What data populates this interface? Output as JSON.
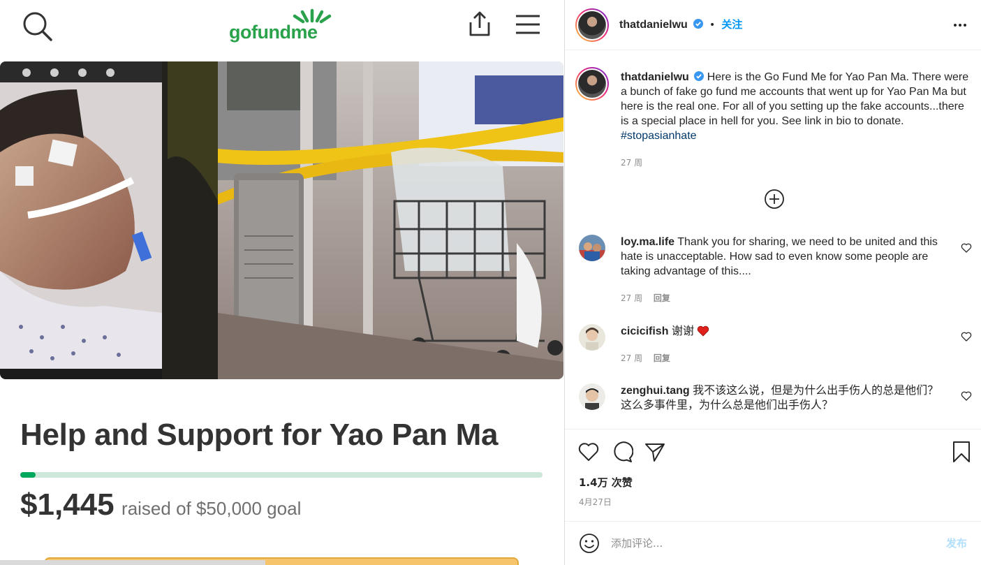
{
  "gofundme": {
    "logo_text": "gofundme",
    "brand_color": "#2aa24c",
    "title": "Help and Support for Yao Pan Ma",
    "raised_amount": "$1,445",
    "raised_text": "raised of $50,000 goal",
    "progress_fraction": 0.029,
    "icons": [
      "search-icon",
      "share-icon",
      "hamburger-menu-icon"
    ]
  },
  "instagram": {
    "header": {
      "username": "thatdanielwu",
      "separator": "•",
      "follow_label": "关注"
    },
    "post": {
      "username": "thatdanielwu",
      "caption": "Here is the Go Fund Me for Yao Pan Ma. There were a bunch of fake go fund me accounts that went up for Yao Pan Ma but here is the real one. For all of you setting up the fake accounts...there is a special place in hell for you. See link in bio to donate.",
      "hashtag": "#stopasianhate",
      "time": "27 周"
    },
    "comments": [
      {
        "username": "loy.ma.life",
        "text": "Thank you for sharing, we need to be united and this hate is unacceptable. How sad to even know some people are taking advantage of this....",
        "time": "27 周",
        "reply": "回复"
      },
      {
        "username": "cicicifish",
        "text": "谢谢",
        "time": "27 周",
        "reply": "回复"
      },
      {
        "username": "zenghui.tang",
        "text": "我不该这么说，但是为什么出手伤人的总是他们？这么多事件里，为什么总是他们出手伤人？"
      }
    ],
    "likes": "1.4万 次赞",
    "date": "4月27日",
    "comment_placeholder": "添加评论...",
    "post_button": "发布",
    "accent_color": "#0095f6"
  }
}
